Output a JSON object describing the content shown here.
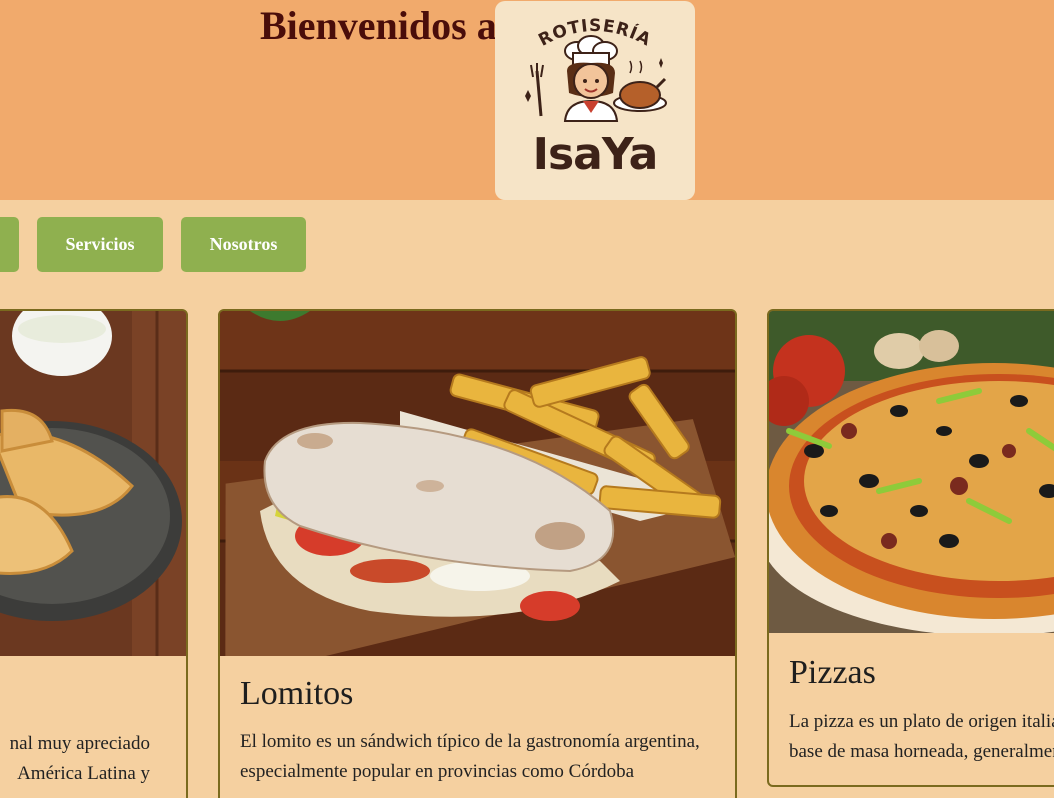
{
  "header": {
    "welcome": "Bienvenidos a",
    "logo": {
      "arc_text": "ROTISERÍA",
      "name": "IsaYa"
    }
  },
  "nav": {
    "items": [
      {
        "label": ""
      },
      {
        "label": "Servicios"
      },
      {
        "label": "Nosotros"
      }
    ]
  },
  "cards": [
    {
      "title": "",
      "text": "nal muy apreciado\nAmérica Latina y",
      "image": "empanadas-photo"
    },
    {
      "title": "Lomitos",
      "text": "El lomito es un sándwich típico de la gastronomía argentina, especialmente popular en provincias como Córdoba",
      "image": "lomito-photo"
    },
    {
      "title": "Pizzas",
      "text": "La pizza es un plato de origen italiano\nbase de masa horneada, generalmente",
      "image": "pizza-photo"
    }
  ],
  "colors": {
    "header_bg": "#f1aa6c",
    "page_bg": "#f5d0a0",
    "nav_button": "#8fb04f",
    "card_border": "#7a6a1e",
    "logo_bg": "#f6e4c7"
  }
}
